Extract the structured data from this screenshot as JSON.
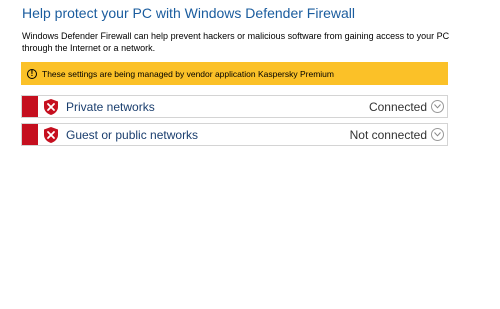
{
  "header": {
    "title": "Help protect your PC with Windows Defender Firewall",
    "description": "Windows Defender Firewall can help prevent hackers or malicious software from gaining access to your PC through the Internet or a network."
  },
  "banner": {
    "text": "These settings are being managed by vendor application Kaspersky Premium",
    "icon": "warning-icon",
    "color": "#fbc128"
  },
  "networks": [
    {
      "label": "Private networks",
      "status": "Connected",
      "status_color": "#c50f1f"
    },
    {
      "label": "Guest or public networks",
      "status": "Not connected",
      "status_color": "#c50f1f"
    }
  ],
  "colors": {
    "title": "#1a5c9e",
    "alert_red": "#c50f1f"
  }
}
